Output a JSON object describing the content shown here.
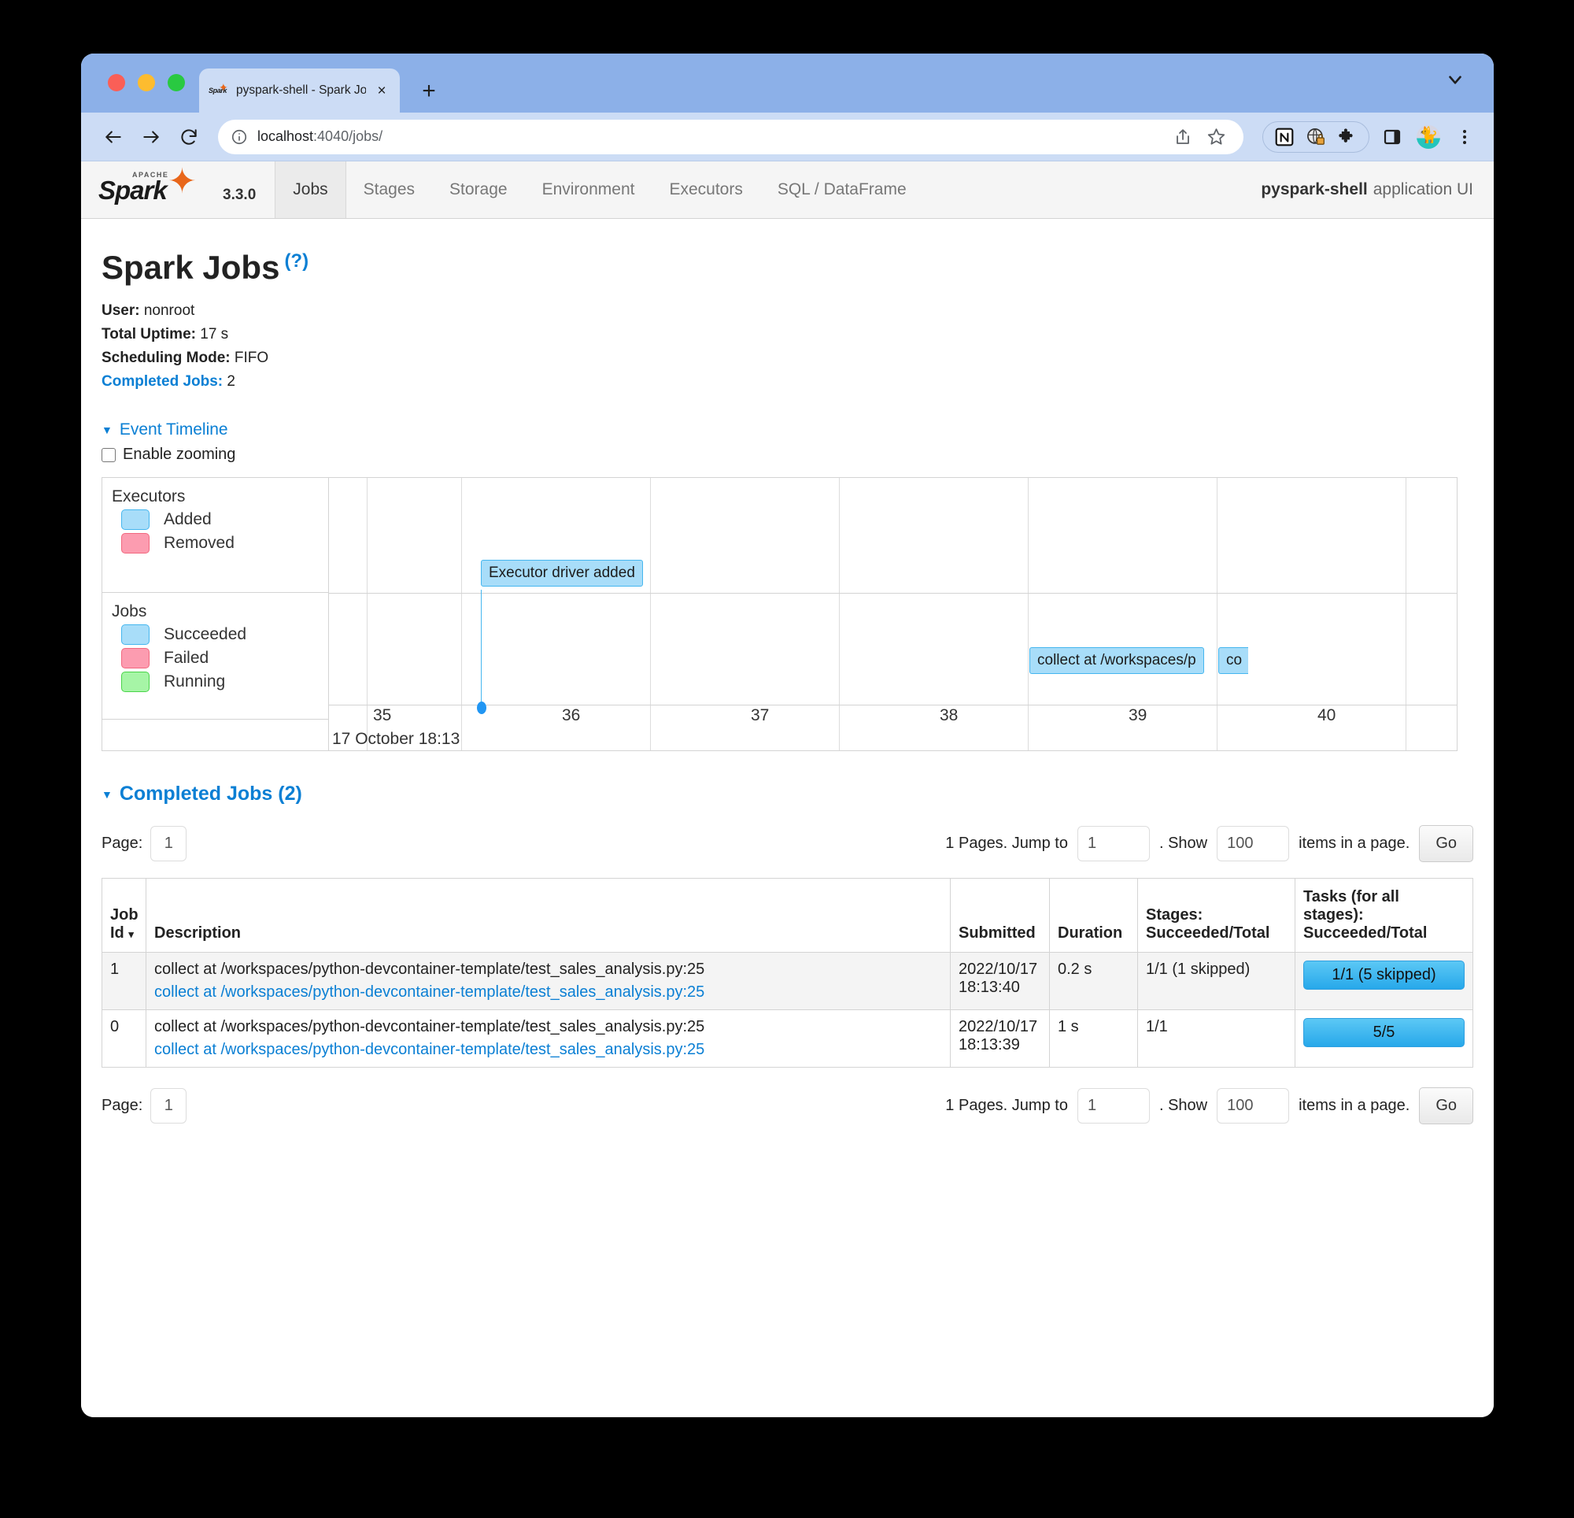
{
  "browser": {
    "tab": {
      "title": "pyspark-shell - Spark Jobs",
      "favicon": "spark-favicon",
      "close": "×"
    },
    "newtab_label": "+",
    "tabstrip_chevron": "chevron-down-icon",
    "url": {
      "host": "localhost",
      "rest": ":4040/jobs/"
    },
    "toolbar_icons": [
      "share-icon",
      "bookmark-star-icon",
      "notion-extension-icon",
      "privacy-badger-extension-icon",
      "extensions-puzzle-icon",
      "side-panel-icon",
      "profile-avatar",
      "kebab-menu-icon"
    ]
  },
  "spark_nav": {
    "brand": {
      "apache": "APACHE",
      "name": "Spark",
      "version": "3.3.0"
    },
    "items": [
      {
        "label": "Jobs",
        "active": true
      },
      {
        "label": "Stages",
        "active": false
      },
      {
        "label": "Storage",
        "active": false
      },
      {
        "label": "Environment",
        "active": false
      },
      {
        "label": "Executors",
        "active": false
      },
      {
        "label": "SQL / DataFrame",
        "active": false
      }
    ],
    "app_name": "pyspark-shell",
    "app_suffix": "application UI"
  },
  "page": {
    "title": "Spark Jobs",
    "help": "(?)",
    "summary": {
      "user_label": "User:",
      "user_value": "nonroot",
      "uptime_label": "Total Uptime:",
      "uptime_value": "17 s",
      "scheduling_label": "Scheduling Mode:",
      "scheduling_value": "FIFO",
      "completed_label": "Completed Jobs:",
      "completed_value": "2"
    }
  },
  "event_timeline": {
    "toggle_label": "Event Timeline",
    "caret": "▼",
    "zoom_label": "Enable zooming",
    "zoom_checked": false,
    "legend": {
      "executors_title": "Executors",
      "executors": [
        {
          "label": "Added",
          "color": "#a8ddf9"
        },
        {
          "label": "Removed",
          "color": "#fc9cb0"
        }
      ],
      "jobs_title": "Jobs",
      "jobs": [
        {
          "label": "Succeeded",
          "color": "#a8ddf9"
        },
        {
          "label": "Failed",
          "color": "#fc9cb0"
        },
        {
          "label": "Running",
          "color": "#a6f5a6"
        }
      ]
    },
    "axis_ticks": [
      "35",
      "36",
      "37",
      "38",
      "39",
      "40"
    ],
    "axis_date": "17 October 18:13",
    "events": [
      {
        "lane": "executors",
        "label": "Executor driver added"
      },
      {
        "lane": "jobs",
        "label": "collect at /workspaces/p"
      },
      {
        "lane": "jobs",
        "label": "co"
      }
    ]
  },
  "completed_jobs": {
    "heading": "Completed Jobs (2)",
    "caret": "▼",
    "pagination": {
      "page_label": "Page:",
      "page_value": "1",
      "pages_text": "1 Pages. Jump to",
      "jump_value": "1",
      "dot_show": ". Show",
      "show_value": "100",
      "items_text": "items in a page.",
      "go_label": "Go"
    },
    "columns": [
      {
        "line1": "Job",
        "line2": "Id",
        "sort": "▾"
      },
      {
        "line1": "",
        "line2": "Description",
        "sort": ""
      },
      {
        "line1": "",
        "line2": "Submitted",
        "sort": ""
      },
      {
        "line1": "",
        "line2": "Duration",
        "sort": ""
      },
      {
        "line1": "Stages:",
        "line2": "Succeeded/Total",
        "sort": ""
      },
      {
        "line1": "Tasks (for all",
        "line1b": "stages):",
        "line2": "Succeeded/Total",
        "sort": ""
      }
    ],
    "rows": [
      {
        "job_id": "1",
        "description_plain": "collect at /workspaces/python-devcontainer-template/test_sales_analysis.py:25",
        "description_link": "collect at /workspaces/python-devcontainer-template/test_sales_analysis.py:25",
        "submitted_date": "2022/10/17",
        "submitted_time": "18:13:40",
        "duration": "0.2 s",
        "stages": "1/1 (1 skipped)",
        "tasks": "1/1 (5 skipped)",
        "tasks_pct": 100
      },
      {
        "job_id": "0",
        "description_plain": "collect at /workspaces/python-devcontainer-template/test_sales_analysis.py:25",
        "description_link": "collect at /workspaces/python-devcontainer-template/test_sales_analysis.py:25",
        "submitted_date": "2022/10/17",
        "submitted_time": "18:13:39",
        "duration": "1 s",
        "stages": "1/1",
        "tasks": "5/5",
        "tasks_pct": 100
      }
    ]
  },
  "colors": {
    "link": "#0a7fd4",
    "accent_blue": "#45b6ef",
    "progress": "#27a8ea",
    "tab_bg": "#8cb0e8"
  }
}
